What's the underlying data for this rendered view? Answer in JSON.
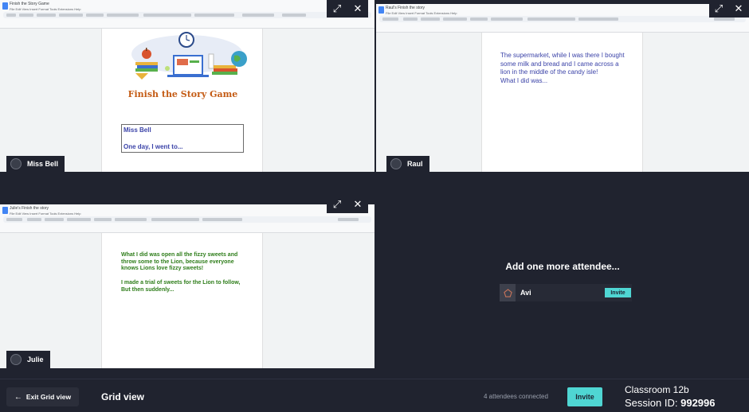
{
  "tiles": {
    "miss_bell": {
      "doc_title": "Finish the Story Game",
      "doc_menu": "File  Edit  View  Insert  Format  Tools  Extensions  Help",
      "game_title": "Finish the Story Game",
      "box_name": "Miss Bell",
      "box_text": "One day, I went to...",
      "name": "Miss Bell"
    },
    "raul": {
      "doc_title": "Raul's Finish the story",
      "doc_menu": "File  Edit  View  Insert  Format  Tools  Extensions  Help",
      "story_text": "The supermarket, while I was there I bought some milk and bread and I came across a lion in the middle of the candy isle!",
      "story_line2": "What I did was...",
      "name": "Raul"
    },
    "julie": {
      "doc_title": "Julie's Finish the story",
      "doc_menu": "File  Edit  View  Insert  Format  Tools  Extensions  Help",
      "para1": "What I did was open all the fizzy sweets and throw some to the Lion, because everyone knows Lions love fizzy sweets!",
      "para2": "I made a trial of sweets for the Lion to follow, But then suddenly...",
      "name": "Julie"
    },
    "add": {
      "heading": "Add one more attendee...",
      "attendee_name": "Avi",
      "invite_label": "Invite"
    }
  },
  "bottom_bar": {
    "exit_label": "Exit Grid view",
    "view_title": "Grid view",
    "attendees_connected": "4 attendees connected",
    "invite_label": "Invite",
    "classroom": "Classroom 12b",
    "session_label": "Session ID:",
    "session_id": "992996"
  },
  "icons": {
    "expand": "expand-icon",
    "close": "close-icon",
    "arrow_left": "arrow-left-icon"
  },
  "colors": {
    "background": "#20232f",
    "accent": "#4fd6d3",
    "story_title": "#c45b14",
    "green_text": "#2e7d1a",
    "blue_text": "#3b43a8"
  }
}
